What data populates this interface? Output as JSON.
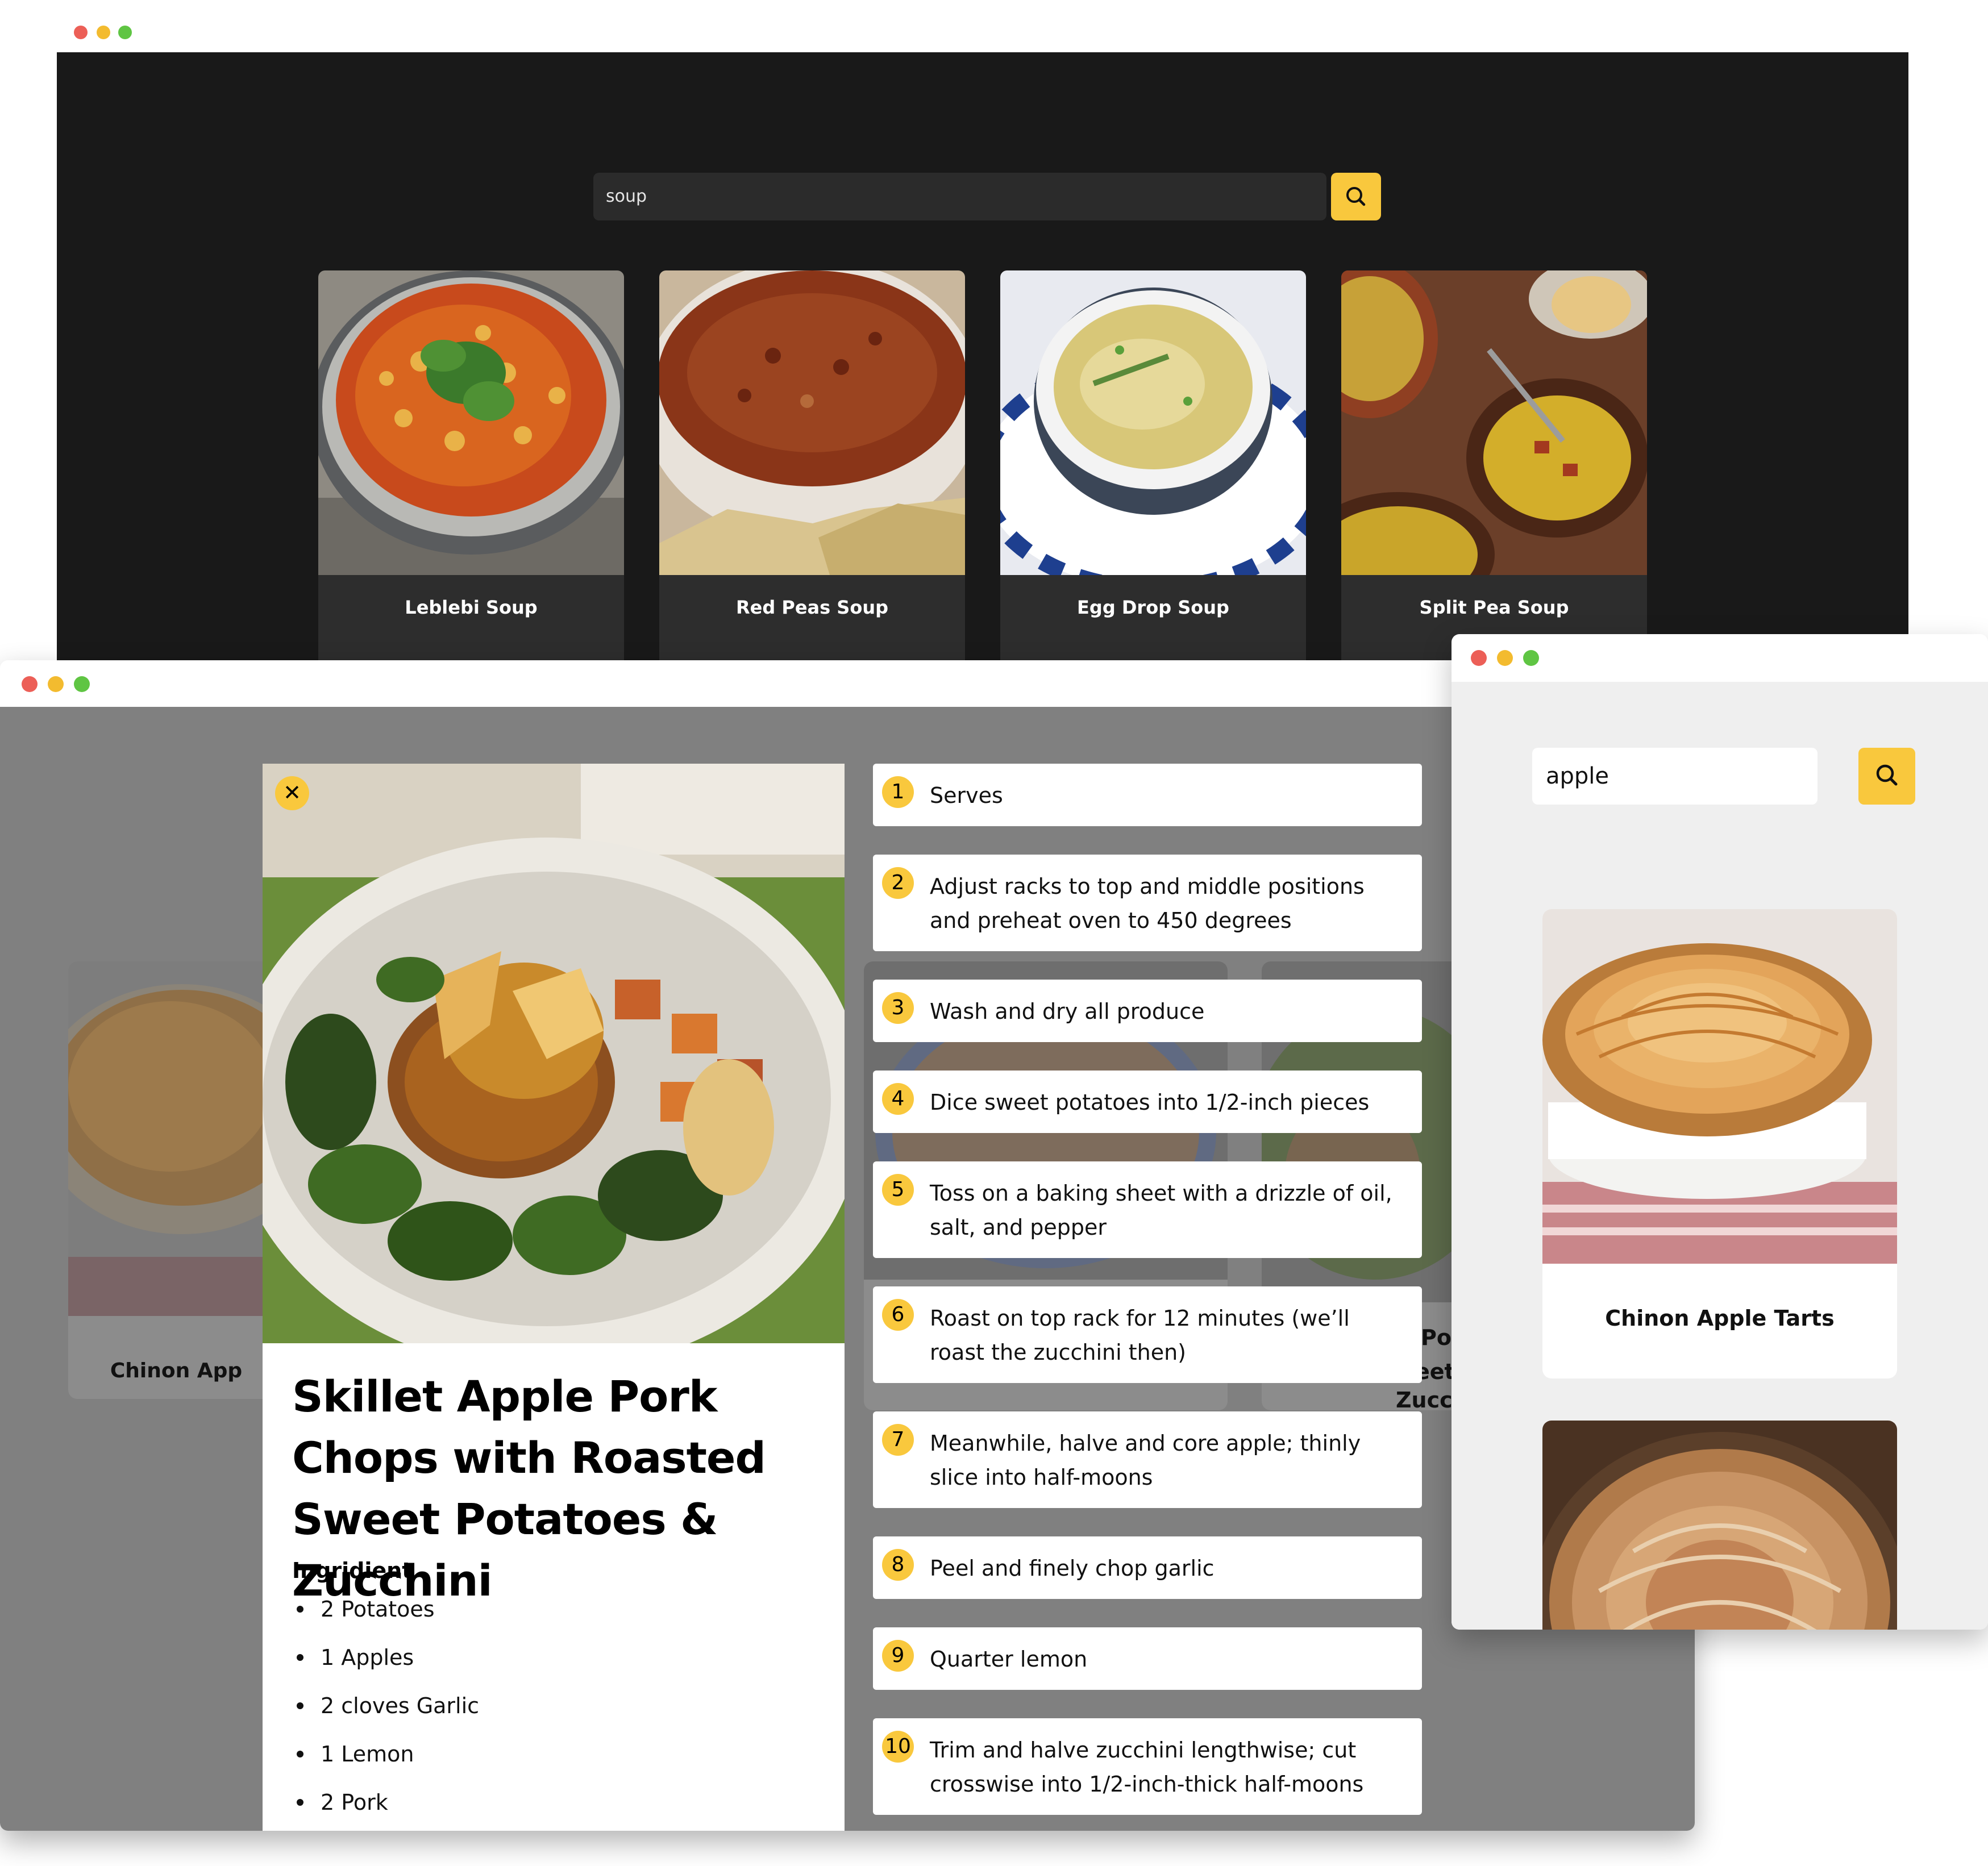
{
  "window_soup": {
    "search_value": "soup",
    "cards": [
      {
        "title": "Leblebi Soup"
      },
      {
        "title": "Red Peas Soup"
      },
      {
        "title": "Egg Drop Soup"
      },
      {
        "title": "Split Pea Soup"
      }
    ]
  },
  "window_detail": {
    "background_cards": [
      {
        "title": "Chinon App"
      },
      {
        "title": "Po"
      },
      {
        "title": "eet"
      },
      {
        "title": "Zucch"
      }
    ],
    "recipe": {
      "title": "Skillet Apple Pork Chops with Roasted Sweet Potatoes & Zucchini",
      "ingredients_heading": "Ingridient",
      "ingredients": [
        "2 Potatoes",
        "1 Apples",
        "2 cloves Garlic",
        "1 Lemon",
        "2 Pork"
      ],
      "steps": [
        {
          "num": "1",
          "text": "Serves"
        },
        {
          "num": "2",
          "text": "Adjust racks to top and middle positions and preheat oven to 450 degrees"
        },
        {
          "num": "3",
          "text": "Wash and dry all produce"
        },
        {
          "num": "4",
          "text": "Dice sweet potatoes into 1/2-inch pieces"
        },
        {
          "num": "5",
          "text": "Toss on a baking sheet with a drizzle of oil, salt, and pepper"
        },
        {
          "num": "6",
          "text": "Roast on top rack for 12 minutes (we’ll roast the zucchini then)"
        },
        {
          "num": "7",
          "text": "Meanwhile, halve and core apple; thinly slice into half-moons"
        },
        {
          "num": "8",
          "text": "Peel and finely chop garlic"
        },
        {
          "num": "9",
          "text": "Quarter lemon"
        },
        {
          "num": "10",
          "text": "Trim and halve zucchini lengthwise; cut crosswise into 1/2-inch-thick half-moons"
        }
      ]
    }
  },
  "window_apple": {
    "search_value": "apple",
    "cards": [
      {
        "title": "Chinon Apple Tarts"
      }
    ]
  },
  "colors": {
    "accent": "#f9c83d",
    "dark_bg": "#191919",
    "card_dark": "#2d2d2d",
    "overlay_bg": "#808080",
    "light_bg": "#efefef"
  }
}
